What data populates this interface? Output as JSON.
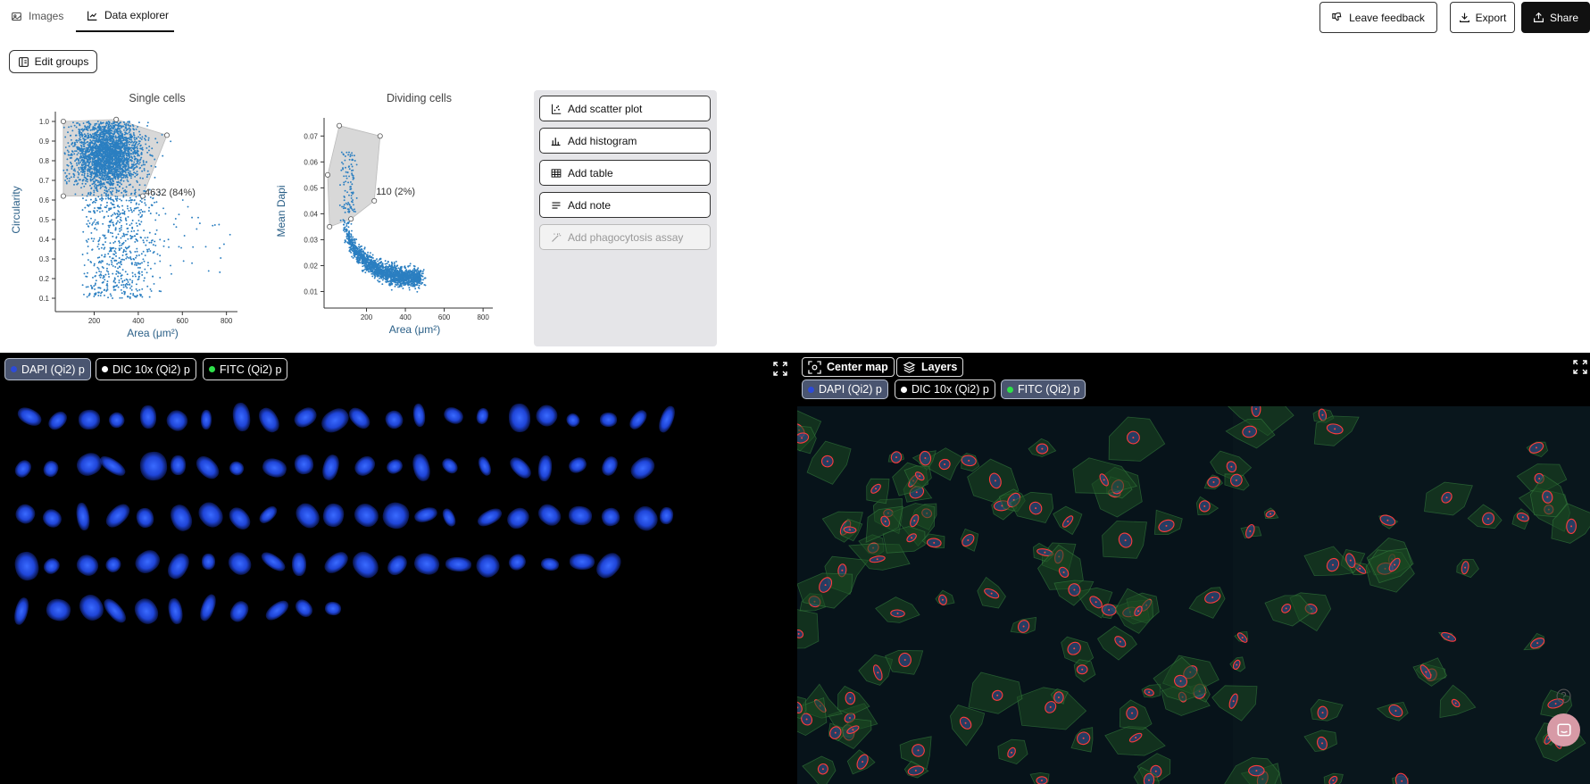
{
  "tabs": [
    {
      "label": "Images",
      "icon": "images-icon",
      "active": false
    },
    {
      "label": "Data explorer",
      "icon": "chart-icon",
      "active": true
    }
  ],
  "header": {
    "feedback_label": "Leave feedback",
    "export_label": "Export",
    "share_label": "Share"
  },
  "toolbar": {
    "edit_groups_label": "Edit groups"
  },
  "chart_data": [
    {
      "type": "scatter",
      "title": "Single cells",
      "xlabel": "Area (μm²)",
      "ylabel": "Circularity",
      "xlim": [
        40,
        850
      ],
      "ylim": [
        0.05,
        1.05
      ],
      "xticks": [
        "200",
        "400",
        "600",
        "800"
      ],
      "yticks": [
        "0.1",
        "0.2",
        "0.3",
        "0.4",
        "0.5",
        "0.6",
        "0.7",
        "0.8",
        "0.9",
        "1.0"
      ],
      "selection_label": "4632 (84%)",
      "selection_polygon": [
        [
          60,
          1.0
        ],
        [
          300,
          1.01
        ],
        [
          530,
          0.93
        ],
        [
          420,
          0.62
        ],
        [
          60,
          0.62
        ]
      ],
      "points_color": "#2b7fc1"
    },
    {
      "type": "scatter",
      "title": "Dividing cells",
      "xlabel": "Area (μm²)",
      "ylabel": "Mean Dapi",
      "xlim": [
        0,
        850
      ],
      "ylim": [
        0.005,
        0.077
      ],
      "xticks": [
        "200",
        "400",
        "600",
        "800"
      ],
      "yticks": [
        "0.01",
        "0.02",
        "0.03",
        "0.04",
        "0.05",
        "0.06",
        "0.07"
      ],
      "selection_label": "110 (2%)",
      "selection_polygon": [
        [
          60,
          0.074
        ],
        [
          270,
          0.07
        ],
        [
          240,
          0.045
        ],
        [
          120,
          0.038
        ],
        [
          10,
          0.035
        ],
        [
          0,
          0.055
        ]
      ],
      "points_color": "#2b7fc1"
    }
  ],
  "panel": {
    "buttons": [
      {
        "label": "Add scatter plot",
        "icon": "scatter-icon"
      },
      {
        "label": "Add histogram",
        "icon": "histogram-icon"
      },
      {
        "label": "Add table",
        "icon": "table-icon"
      },
      {
        "label": "Add note",
        "icon": "note-icon"
      },
      {
        "label": "Add phagocytosis assay",
        "icon": "wand-icon",
        "disabled": true
      }
    ]
  },
  "left_viewer": {
    "channels": [
      {
        "label": "DAPI (Qi2) p",
        "color": "#2d4bd8",
        "selected": true
      },
      {
        "label": "DIC 10x (Qi2) p",
        "color": "#ffffff",
        "selected": false
      },
      {
        "label": "FITC (Qi2) p",
        "color": "#2ee04a",
        "selected": false
      }
    ]
  },
  "right_viewer": {
    "center_map_label": "Center map",
    "layers_label": "Layers",
    "channels": [
      {
        "label": "DAPI (Qi2) p",
        "color": "#2d4bd8",
        "selected": true
      },
      {
        "label": "DIC 10x (Qi2) p",
        "color": "#ffffff",
        "selected": false
      },
      {
        "label": "FITC (Qi2) p",
        "color": "#2ee04a",
        "selected": true
      }
    ]
  },
  "colors": {
    "accent": "#2b7fc1",
    "dark_bg": "#000000",
    "panel_bg": "#e5e5e8"
  }
}
